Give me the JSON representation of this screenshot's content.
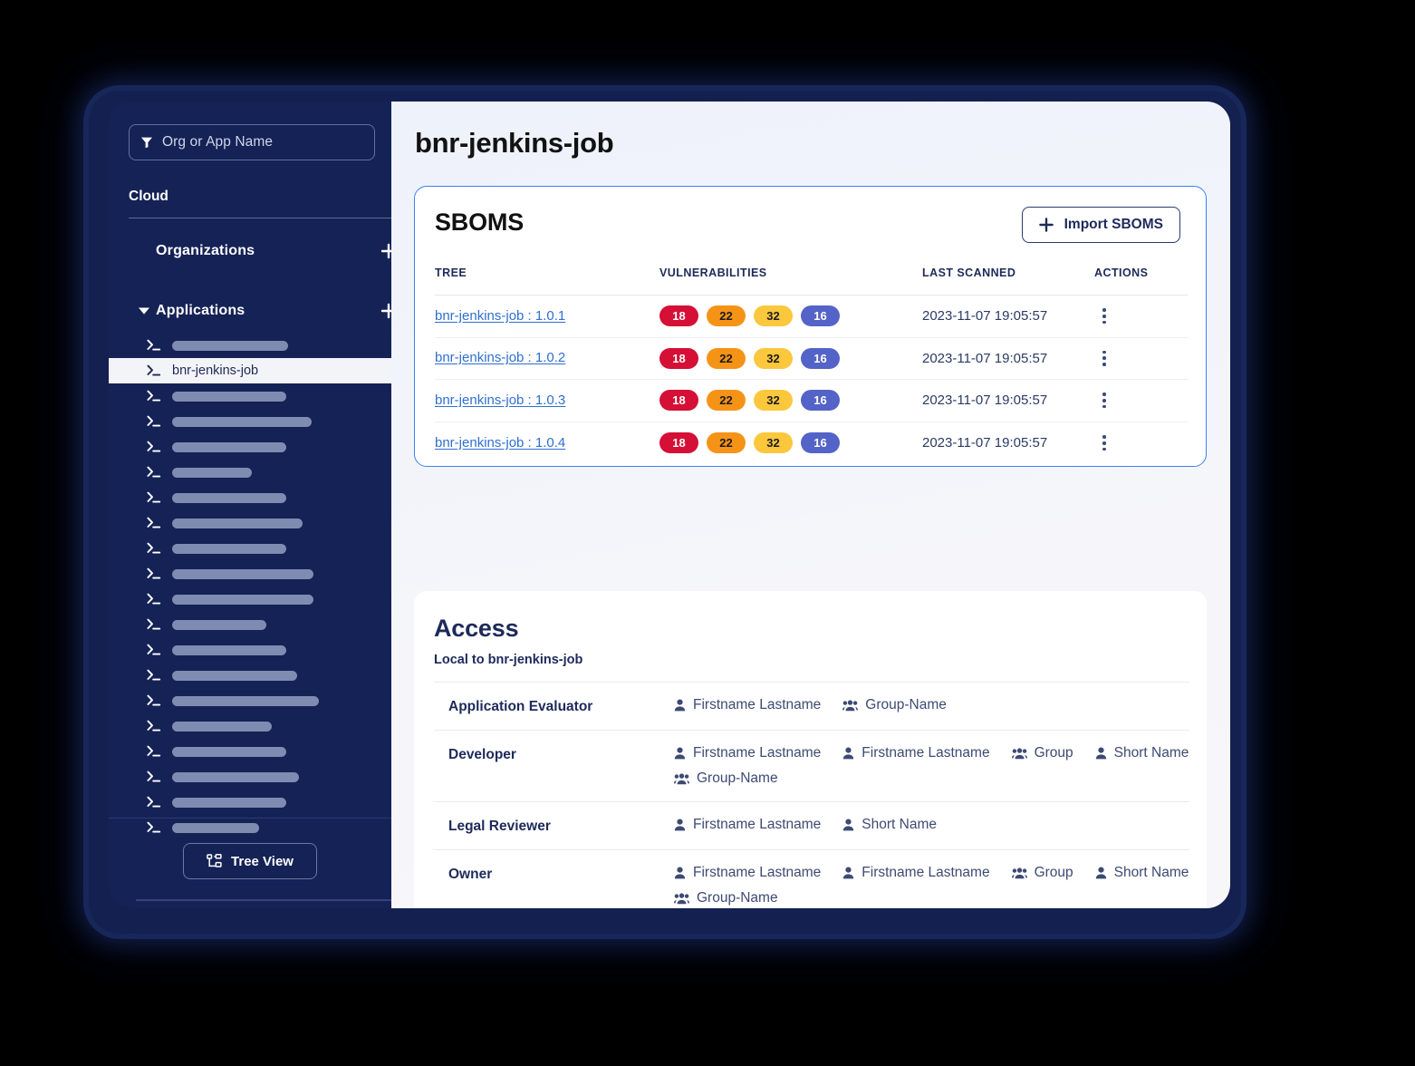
{
  "sidebar": {
    "search": {
      "placeholder": "Org or App Name",
      "icon": "filter-icon"
    },
    "cloud_label": "Cloud",
    "groups": [
      {
        "label": "Organizations",
        "expanded": false,
        "add_icon": "plus-icon"
      },
      {
        "label": "Applications",
        "expanded": true,
        "add_icon": "plus-icon"
      }
    ],
    "applications": [
      {
        "name": "",
        "placeholder_width": 128,
        "selected": false
      },
      {
        "name": "bnr-jenkins-job",
        "placeholder_width": 0,
        "selected": true
      },
      {
        "name": "",
        "placeholder_width": 126,
        "selected": false
      },
      {
        "name": "",
        "placeholder_width": 154,
        "selected": false
      },
      {
        "name": "",
        "placeholder_width": 126,
        "selected": false
      },
      {
        "name": "",
        "placeholder_width": 88,
        "selected": false
      },
      {
        "name": "",
        "placeholder_width": 126,
        "selected": false
      },
      {
        "name": "",
        "placeholder_width": 144,
        "selected": false
      },
      {
        "name": "",
        "placeholder_width": 126,
        "selected": false
      },
      {
        "name": "",
        "placeholder_width": 156,
        "selected": false
      },
      {
        "name": "",
        "placeholder_width": 156,
        "selected": false
      },
      {
        "name": "",
        "placeholder_width": 104,
        "selected": false
      },
      {
        "name": "",
        "placeholder_width": 126,
        "selected": false
      },
      {
        "name": "",
        "placeholder_width": 138,
        "selected": false
      },
      {
        "name": "",
        "placeholder_width": 162,
        "selected": false
      },
      {
        "name": "",
        "placeholder_width": 110,
        "selected": false
      },
      {
        "name": "",
        "placeholder_width": 126,
        "selected": false
      },
      {
        "name": "",
        "placeholder_width": 140,
        "selected": false
      },
      {
        "name": "",
        "placeholder_width": 126,
        "selected": false
      },
      {
        "name": "",
        "placeholder_width": 96,
        "selected": false
      }
    ],
    "tree_view_button": {
      "label": "Tree View",
      "icon": "tree-view-icon"
    }
  },
  "main": {
    "page_title": "bnr-jenkins-job",
    "sboms": {
      "title": "SBOMS",
      "import_button": {
        "label": "Import SBOMS",
        "icon": "plus-icon"
      },
      "columns": [
        "TREE",
        "VULNERABILITIES",
        "LAST SCANNED",
        "ACTIONS"
      ],
      "rows": [
        {
          "tree": "bnr-jenkins-job : 1.0.1",
          "vulnerabilities": {
            "critical": "18",
            "high": "22",
            "medium": "32",
            "low": "16"
          },
          "last_scanned": "2023-11-07 19:05:57",
          "actions_icon": "kebab-menu-icon"
        },
        {
          "tree": "bnr-jenkins-job : 1.0.2",
          "vulnerabilities": {
            "critical": "18",
            "high": "22",
            "medium": "32",
            "low": "16"
          },
          "last_scanned": "2023-11-07 19:05:57",
          "actions_icon": "kebab-menu-icon"
        },
        {
          "tree": "bnr-jenkins-job : 1.0.3",
          "vulnerabilities": {
            "critical": "18",
            "high": "22",
            "medium": "32",
            "low": "16"
          },
          "last_scanned": "2023-11-07 19:05:57",
          "actions_icon": "kebab-menu-icon"
        },
        {
          "tree": "bnr-jenkins-job : 1.0.4",
          "vulnerabilities": {
            "critical": "18",
            "high": "22",
            "medium": "32",
            "low": "16"
          },
          "last_scanned": "2023-11-07 19:05:57",
          "actions_icon": "kebab-menu-icon"
        }
      ]
    },
    "access": {
      "title": "Access",
      "subtitle": "Local to bnr-jenkins-job",
      "rows": [
        {
          "role": "Application Evaluator",
          "members": [
            {
              "type": "user",
              "name": "Firstname Lastname"
            },
            {
              "type": "group",
              "name": "Group-Name"
            }
          ]
        },
        {
          "role": "Developer",
          "members": [
            {
              "type": "user",
              "name": "Firstname Lastname"
            },
            {
              "type": "user",
              "name": "Firstname Lastname"
            },
            {
              "type": "group",
              "name": "Group"
            },
            {
              "type": "user",
              "name": "Short Name"
            },
            {
              "type": "group",
              "name": "Group-Name"
            }
          ]
        },
        {
          "role": "Legal Reviewer",
          "members": [
            {
              "type": "user",
              "name": "Firstname Lastname"
            },
            {
              "type": "user",
              "name": "Short Name"
            }
          ]
        },
        {
          "role": "Owner",
          "members": [
            {
              "type": "user",
              "name": "Firstname Lastname"
            },
            {
              "type": "user",
              "name": "Firstname Lastname"
            },
            {
              "type": "group",
              "name": "Group"
            },
            {
              "type": "user",
              "name": "Short Name"
            },
            {
              "type": "group",
              "name": "Group-Name"
            }
          ]
        }
      ]
    }
  },
  "colors": {
    "background": "#000000",
    "sidebar": "#152256",
    "accent_blue": "#3b82f6",
    "link": "#2f6fd0",
    "navy": "#1e2a5a",
    "badge_critical": "#d50f35",
    "badge_high": "#f59317",
    "badge_medium": "#fbc73c",
    "badge_low": "#5463c7"
  }
}
